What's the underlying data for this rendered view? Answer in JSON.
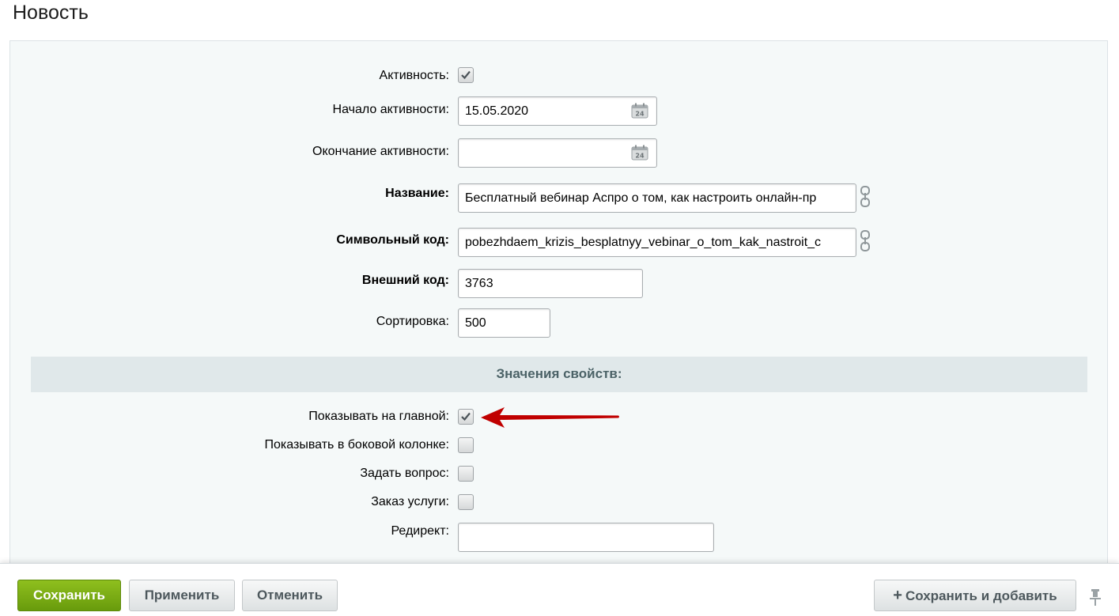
{
  "page": {
    "title": "Новость"
  },
  "fields": {
    "active": {
      "label": "Активность:",
      "checked": true
    },
    "active_from": {
      "label": "Начало активности:",
      "value": "15.05.2020"
    },
    "active_to": {
      "label": "Окончание активности:",
      "value": ""
    },
    "name": {
      "label": "Название:",
      "value": "Бесплатный вебинар Аспро о том, как настроить онлайн-пр"
    },
    "code": {
      "label": "Символьный код:",
      "value": "pobezhdaem_krizis_besplatnyy_vebinar_o_tom_kak_nastroit_c"
    },
    "xml_id": {
      "label": "Внешний код:",
      "value": "3763"
    },
    "sort": {
      "label": "Сортировка:",
      "value": "500"
    }
  },
  "properties": {
    "header": "Значения свойств:",
    "show_main": {
      "label": "Показывать на главной:",
      "checked": true
    },
    "show_side": {
      "label": "Показывать в боковой колонке:",
      "checked": false
    },
    "ask_question": {
      "label": "Задать вопрос:",
      "checked": false
    },
    "order_service": {
      "label": "Заказ услуги:",
      "checked": false
    },
    "redirect": {
      "label": "Редирект:",
      "value": ""
    }
  },
  "footer": {
    "save": "Сохранить",
    "apply": "Применить",
    "cancel": "Отменить",
    "save_and_add": "Сохранить и добавить"
  },
  "icons": {
    "calendar": "calendar-icon",
    "translit": "translit-link-icon",
    "pin": "pin-icon",
    "plus": "plus-icon"
  },
  "colors": {
    "save_button": "#7aad13",
    "panel_bg": "#f5f9f9",
    "section_bg": "#e0e8ea",
    "annotation_arrow": "#c00000"
  }
}
